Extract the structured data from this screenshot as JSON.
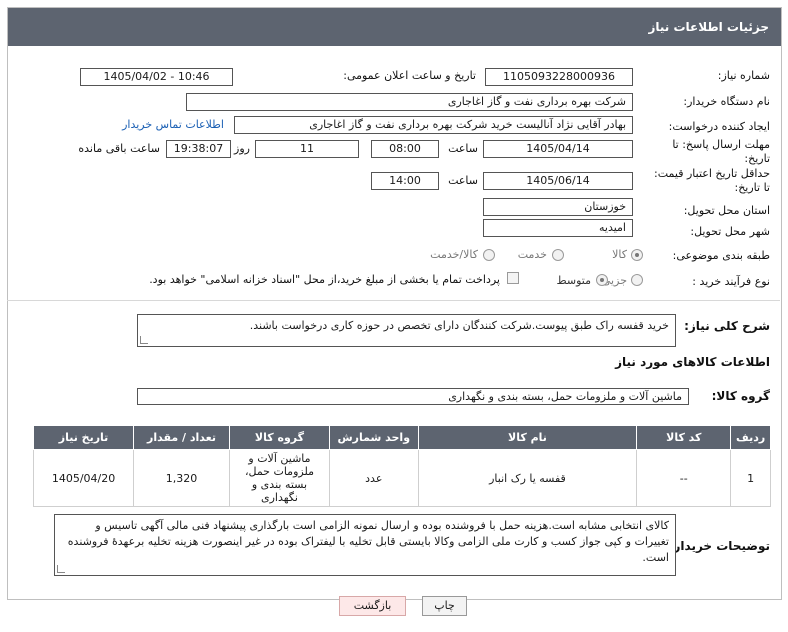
{
  "header": {
    "title": "جزئیات اطلاعات نیاز"
  },
  "form": {
    "need_number": {
      "label": "شماره نیاز:",
      "value": "1105093228000936"
    },
    "announce_datetime": {
      "label": "تاریخ و ساعت اعلان عمومی:",
      "value": "1405/04/02 - 10:46"
    },
    "buyer_org": {
      "label": "نام دستگاه خریدار:",
      "value": "شرکت بهره برداری نفت و گاز اغاجاری"
    },
    "requester": {
      "label": "ایجاد کننده درخواست:",
      "value": "بهادر  آقایی نژاد آنالیست خرید شرکت بهره برداری نفت و گاز اغاجاری",
      "contact_link": "اطلاعات تماس خریدار"
    },
    "reply_deadline": {
      "label": "مهلت ارسال پاسخ: تا تاریخ:",
      "date": "1405/04/14",
      "time_label": "ساعت",
      "time": "08:00",
      "days": "11",
      "days_label": "روز و",
      "remaining": "19:38:07",
      "remaining_label": "ساعت باقی مانده"
    },
    "price_validity": {
      "label": "حداقل تاریخ اعتبار قیمت: تا تاریخ:",
      "date": "1405/06/14",
      "time_label": "ساعت",
      "time": "14:00"
    },
    "province": {
      "label": "استان محل تحویل:",
      "value": "خوزستان"
    },
    "city": {
      "label": "شهر محل تحویل:",
      "value": "امیدیه"
    },
    "category": {
      "label": "طبقه بندی موضوعی:",
      "options": [
        "کالا",
        "خدمت",
        "کالا/خدمت"
      ],
      "selected": "کالا"
    },
    "process": {
      "label": "نوع فرآیند خرید :",
      "options": [
        "جزیی",
        "متوسط"
      ],
      "selected": "متوسط",
      "payment_note": "پرداخت تمام یا بخشی از مبلغ خرید،از محل \"اسناد خزانه اسلامی\" خواهد بود."
    },
    "description": {
      "label": "شرح کلی نیاز:",
      "value": "خرید قفسه راک طبق پیوست.شرکت کنندگان دارای تخصص در حوزه کاری درخواست باشند."
    }
  },
  "goods": {
    "section_title": "اطلاعات کالاهای مورد نیاز",
    "group_label": "گروه کالا:",
    "group_value": "ماشین آلات و ملزومات حمل، بسته بندی و نگهداری",
    "columns": [
      "ردیف",
      "کد کالا",
      "نام کالا",
      "واحد شمارش",
      "گروه کالا",
      "تعداد / مقدار",
      "تاریخ نیاز"
    ],
    "rows": [
      {
        "row": "1",
        "code": "--",
        "name": "قفسه یا رک انبار",
        "unit": "عدد",
        "group": "ماشین آلات و ملزومات حمل، بسته بندی و نگهداری",
        "qty": "1,320",
        "date": "1405/04/20"
      }
    ]
  },
  "buyer_notes": {
    "label": "توضیحات خریدار:",
    "value": "کالای انتخابی مشابه است.هزینه حمل با فروشنده بوده و ارسال نمونه الزامی است بارگذاری پیشنهاد فنی مالی آگهی تاسیس و تغییرات و کپی جواز کسب و کارت ملی الزامی وکالا بایستی قابل تخلیه با لیفتراک بوده در غیر اینصورت هزینه تخلیه برعهدهٔ فروشنده است."
  },
  "buttons": {
    "print": "چاپ",
    "back": "بازگشت"
  },
  "colors": {
    "header_bg": "#5d6470",
    "link": "#1a5fb4"
  }
}
